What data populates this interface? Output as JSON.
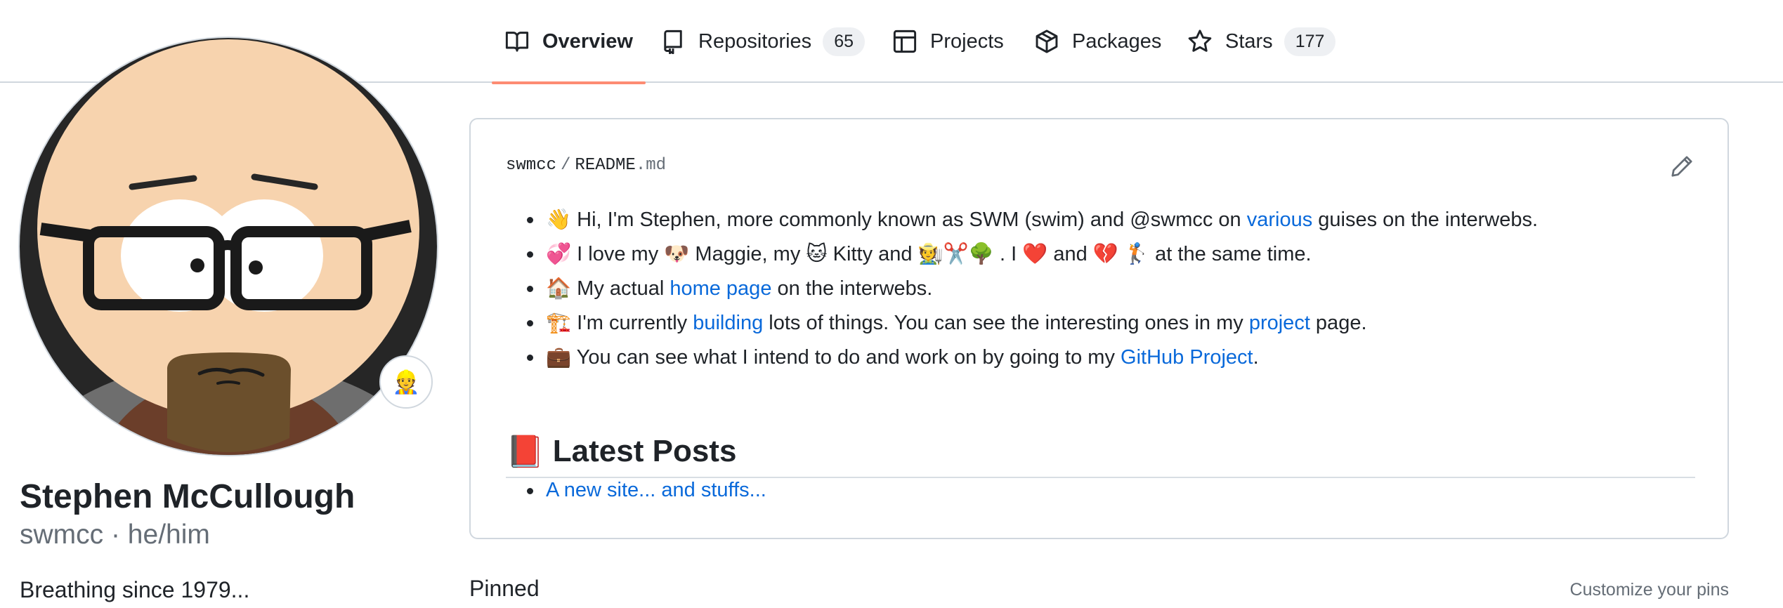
{
  "nav": {
    "tabs": [
      {
        "label": "Overview",
        "icon": "book-icon",
        "selected": true
      },
      {
        "label": "Repositories",
        "icon": "repo-icon",
        "count": "65"
      },
      {
        "label": "Projects",
        "icon": "table-icon"
      },
      {
        "label": "Packages",
        "icon": "package-icon"
      },
      {
        "label": "Stars",
        "icon": "star-icon",
        "count": "177"
      }
    ]
  },
  "profile": {
    "name": "Stephen McCullough",
    "login": "swmcc · he/him",
    "bio": "Breathing since 1979...",
    "status_emoji": "👷"
  },
  "readme": {
    "owner": "swmcc",
    "separator": "/",
    "file_base": "README",
    "file_ext": ".md",
    "intro": [
      {
        "emoji": "👋",
        "text_a": " Hi, I'm Stephen, more commonly known as SWM (swim) and @swmcc on ",
        "link": "various",
        "text_b": " guises on the interwebs."
      },
      {
        "emoji": "💞",
        "text_a": " I love my ",
        "emoji_b": "🐶",
        "text_b": " Maggie, my ",
        "emoji_c": "🐱",
        "text_c": " Kitty and ",
        "emoji_d": "🧑‍🌾✂️🌳",
        "text_d": " . I ",
        "emoji_e": "❤️",
        "text_e": " and ",
        "emoji_f": "💔",
        "text_f": " ",
        "emoji_g": "🏌️",
        "text_g": " at the same time."
      },
      {
        "emoji": "🏠",
        "text_a": " My actual ",
        "link": "home page",
        "text_b": " on the interwebs."
      },
      {
        "emoji": "🏗️",
        "text_a": " I'm currently ",
        "link": "building",
        "text_b": " lots of things. You can see the interesting ones in my ",
        "link2": "project",
        "text_c": " page."
      },
      {
        "emoji": "💼",
        "text_a": " You can see what I intend to do and work on by going to my ",
        "link": "GitHub Project",
        "text_b": "."
      }
    ],
    "posts_heading_emoji": "📕",
    "posts_heading": "Latest Posts",
    "posts": [
      "A new site... and stuffs..."
    ]
  },
  "pinned": {
    "title": "Pinned",
    "customize": "Customize your pins"
  },
  "colors": {
    "accent_underline": "#fd8c73",
    "link": "#0969da",
    "border": "#d0d7de",
    "text": "#1f2328",
    "muted": "#656d76"
  }
}
